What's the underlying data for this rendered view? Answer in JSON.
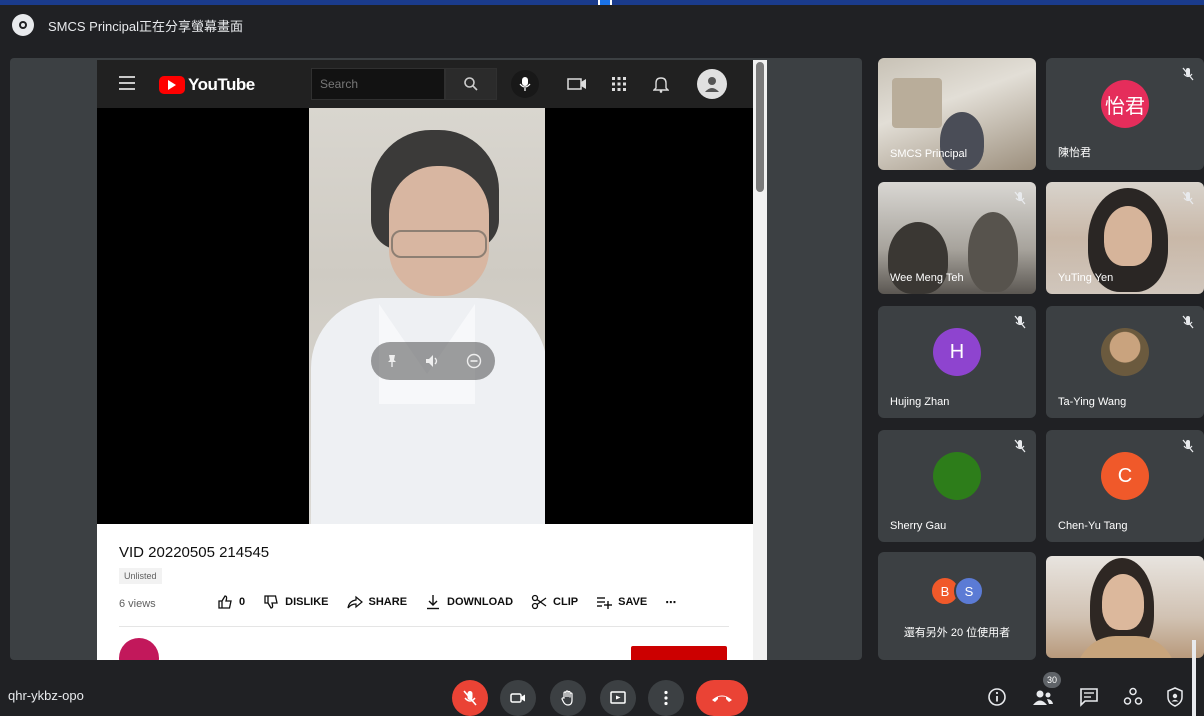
{
  "header": {
    "title": "SMCS Principal正在分享螢幕畫面"
  },
  "youtube": {
    "logo_text": "YouTube",
    "search_placeholder": "Search",
    "video_title": "VID 20220505 214545",
    "unlisted_label": "Unlisted",
    "views": "6 views",
    "like_count": "0",
    "actions": {
      "dislike": "DISLIKE",
      "share": "SHARE",
      "download": "DOWNLOAD",
      "clip": "CLIP",
      "save": "SAVE",
      "more": "⋯"
    }
  },
  "participants": {
    "tiles": [
      {
        "name": "SMCS Principal",
        "type": "video"
      },
      {
        "name": "陳怡君",
        "type": "avatar",
        "initials": "怡君",
        "color": "#e52d5b"
      },
      {
        "name": "Wee Meng Teh",
        "type": "video"
      },
      {
        "name": "YuTing Yen",
        "type": "video"
      },
      {
        "name": "Hujing Zhan",
        "type": "avatar",
        "initials": "H",
        "color": "#8e44cf"
      },
      {
        "name": "Ta-Ying Wang",
        "type": "photo-avatar"
      },
      {
        "name": "Sherry Gau",
        "type": "avatar",
        "initials": "",
        "color": "#2d7d1a"
      },
      {
        "name": "Chen-Yu Tang",
        "type": "avatar",
        "initials": "C",
        "color": "#f0592a"
      },
      {
        "name": "others",
        "type": "group"
      },
      {
        "name": "",
        "type": "video"
      }
    ],
    "others": {
      "label": "還有另外 20 位使用者",
      "avatar1": "B",
      "avatar1_color": "#f0592a",
      "avatar2": "S",
      "avatar2_color": "#5b7bd5"
    }
  },
  "bottom_bar": {
    "meeting_code": "qhr-ykbz-opo",
    "participant_count": "30",
    "colors": {
      "red": "#ea4335",
      "control_bg": "#3c4043"
    }
  }
}
